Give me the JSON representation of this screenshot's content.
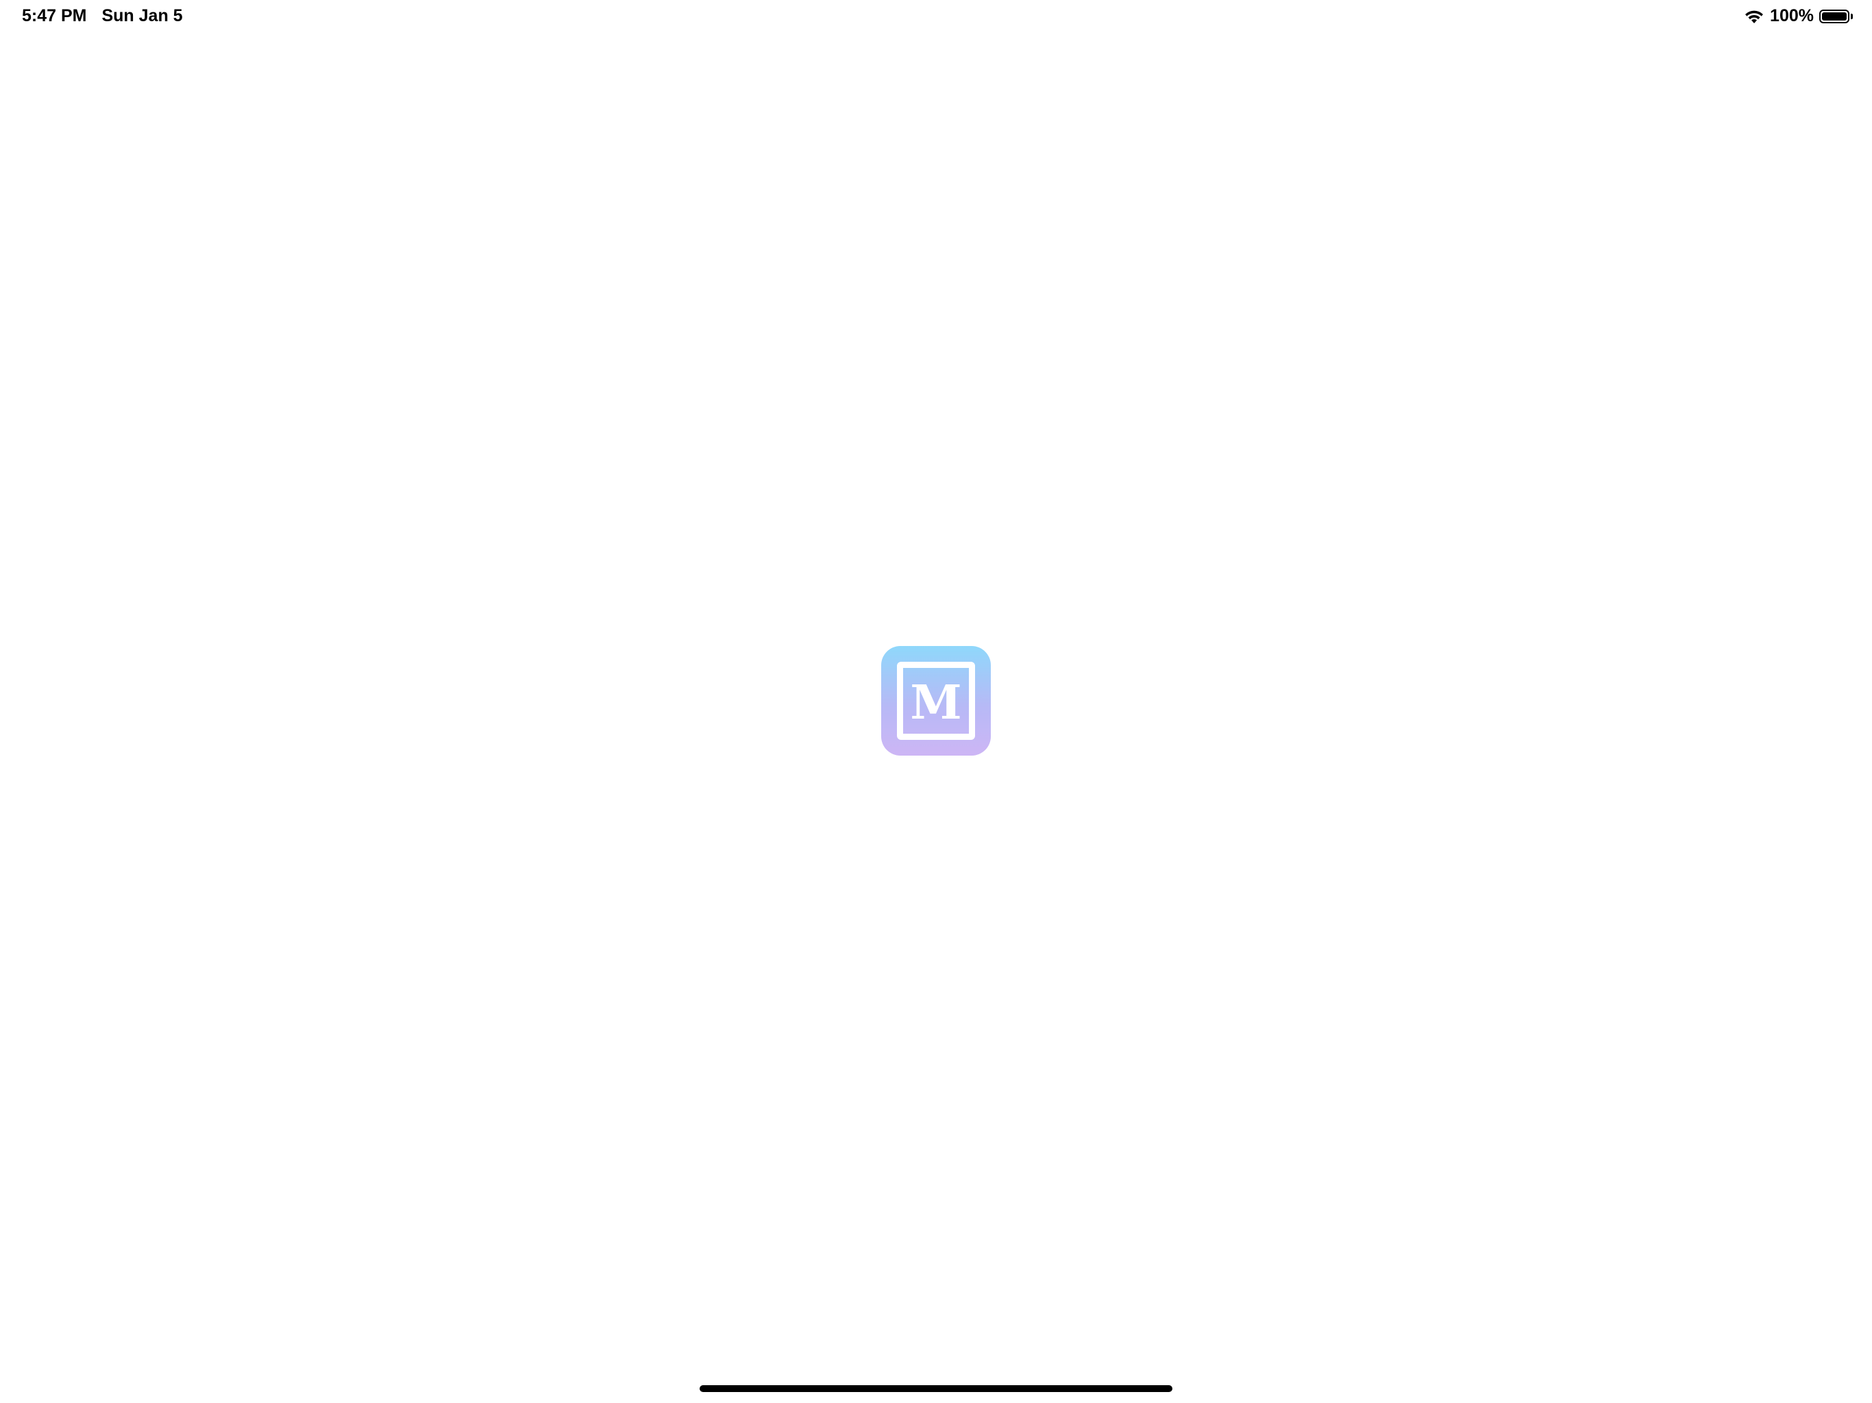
{
  "status_bar": {
    "time": "5:47 PM",
    "date": "Sun Jan 5",
    "battery_percent_label": "100%",
    "battery_level": 1.0,
    "wifi_icon": "wifi-icon",
    "battery_icon": "battery-icon"
  },
  "splash": {
    "logo_letter": "M",
    "logo_colors": {
      "top": "#8fd8fb",
      "bottom": "#cdb6f5",
      "frame": "#ffffff"
    }
  }
}
